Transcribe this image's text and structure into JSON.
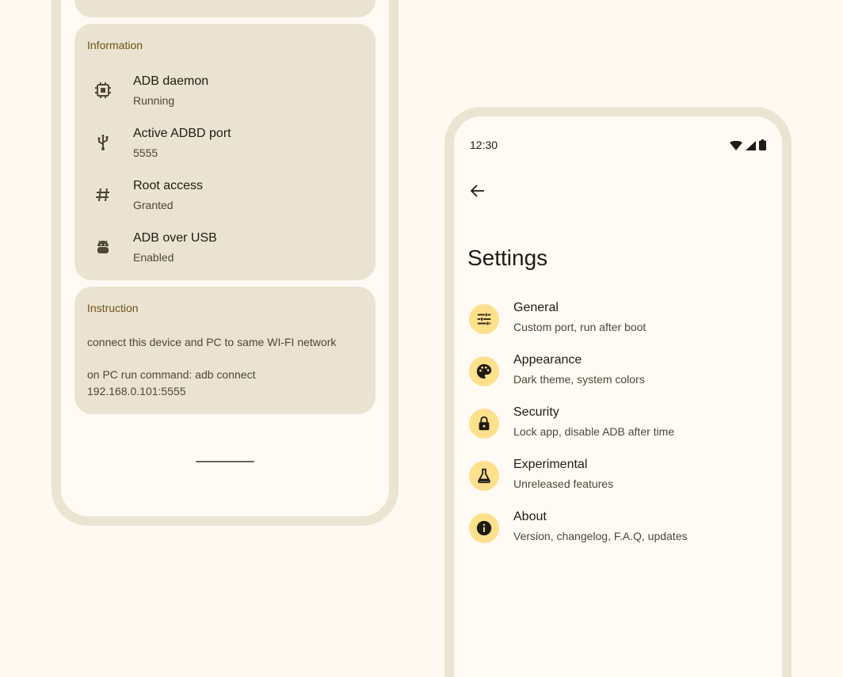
{
  "colors": {
    "background": "#fefaf1",
    "card": "#ebe3d1",
    "accent_text": "#6b5410",
    "icon_badge": "#ffe08d"
  },
  "left": {
    "information": {
      "title": "Information",
      "items": [
        {
          "icon": "chip-icon",
          "title": "ADB daemon",
          "subtitle": "Running"
        },
        {
          "icon": "usb-icon",
          "title": "Active ADBD port",
          "subtitle": "5555"
        },
        {
          "icon": "hashtag-icon",
          "title": "Root access",
          "subtitle": "Granted"
        },
        {
          "icon": "android-icon",
          "title": "ADB over USB",
          "subtitle": "Enabled"
        }
      ]
    },
    "instruction": {
      "title": "Instruction",
      "step1": "connect this device and PC to same WI-FI network",
      "step2": "on PC run command: adb connect 192.168.0.101:5555"
    }
  },
  "right": {
    "status": {
      "time": "12:30",
      "icons": [
        "wifi-icon",
        "signal-icon",
        "battery-icon"
      ]
    },
    "back_icon": "arrow-back-icon",
    "title": "Settings",
    "items": [
      {
        "icon": "tune-icon",
        "title": "General",
        "subtitle": "Custom port, run after boot"
      },
      {
        "icon": "palette-icon",
        "title": "Appearance",
        "subtitle": "Dark theme, system colors"
      },
      {
        "icon": "lock-icon",
        "title": "Security",
        "subtitle": "Lock app, disable ADB after time"
      },
      {
        "icon": "flask-icon",
        "title": "Experimental",
        "subtitle": "Unreleased features"
      },
      {
        "icon": "info-icon",
        "title": "About",
        "subtitle": "Version, changelog, F.A.Q, updates"
      }
    ]
  }
}
